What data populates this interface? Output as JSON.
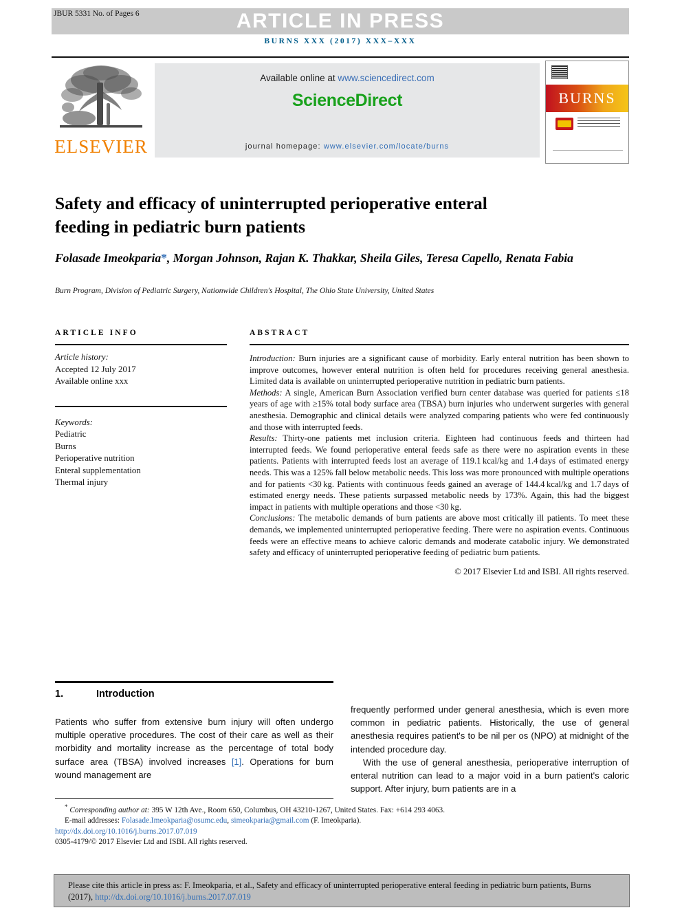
{
  "header": {
    "jbur_label": "JBUR 5331 No. of Pages 6",
    "press_banner": "ARTICLE IN PRESS",
    "journal_line": "BURNS XXX (2017) XXX–XXX"
  },
  "masthead": {
    "publisher": "ELSEVIER",
    "available_prefix": "Available online at ",
    "available_url": "www.sciencedirect.com",
    "sciencedirect_logo": "ScienceDirect",
    "homepage_label": "journal homepage: ",
    "homepage_url": "www.elsevier.com/locate/burns",
    "cover_title": "BURNS"
  },
  "article": {
    "title": "Safety and efficacy of uninterrupted perioperative enteral feeding in pediatric burn patients",
    "authors": "Folasade Imeokparia",
    "authors_rest": ", Morgan Johnson, Rajan K. Thakkar, Sheila Giles, Teresa Capello, Renata Fabia",
    "corresponding_marker": "*",
    "affiliation": "Burn Program, Division of Pediatric Surgery, Nationwide Children's Hospital, The Ohio State University, United States"
  },
  "article_info": {
    "heading": "ARTICLE INFO",
    "history_label": "Article history:",
    "accepted": "Accepted 12 July 2017",
    "available_online": "Available online xxx",
    "keywords_label": "Keywords:",
    "keywords": [
      "Pediatric",
      "Burns",
      "Perioperative nutrition",
      "Enteral supplementation",
      "Thermal injury"
    ]
  },
  "abstract": {
    "heading": "ABSTRACT",
    "sections": [
      {
        "label": "Introduction:",
        "text": " Burn injuries are a significant cause of morbidity. Early enteral nutrition has been shown to improve outcomes, however enteral nutrition is often held for procedures receiving general anesthesia. Limited data is available on uninterrupted perioperative nutrition in pediatric burn patients."
      },
      {
        "label": "Methods:",
        "text": " A single, American Burn Association verified burn center database was queried for patients ≤18 years of age with ≥15% total body surface area (TBSA) burn injuries who underwent surgeries with general anesthesia. Demographic and clinical details were analyzed comparing patients who were fed continuously and those with interrupted feeds."
      },
      {
        "label": "Results:",
        "text": " Thirty-one patients met inclusion criteria. Eighteen had continuous feeds and thirteen had interrupted feeds. We found perioperative enteral feeds safe as there were no aspiration events in these patients. Patients with interrupted feeds lost an average of 119.1 kcal/kg and 1.4 days of estimated energy needs. This was a 125% fall below metabolic needs. This loss was more pronounced with multiple operations and for patients <30 kg. Patients with continuous feeds gained an average of 144.4 kcal/kg and 1.7 days of estimated energy needs. These patients surpassed metabolic needs by 173%. Again, this had the biggest impact in patients with multiple operations and those <30 kg."
      },
      {
        "label": "Conclusions:",
        "text": " The metabolic demands of burn patients are above most critically ill patients. To meet these demands, we implemented uninterrupted perioperative feeding. There were no aspiration events. Continuous feeds were an effective means to achieve caloric demands and moderate catabolic injury. We demonstrated safety and efficacy of uninterrupted perioperative feeding of pediatric burn patients."
      }
    ],
    "copyright": "© 2017 Elsevier Ltd and ISBI. All rights reserved."
  },
  "introduction": {
    "number": "1.",
    "title": "Introduction",
    "left_paragraphs": [
      "Patients who suffer from extensive burn injury will often undergo multiple operative procedures. The cost of their care as well as their morbidity and mortality increase as the percentage of total body surface area (TBSA) involved increases ",
      ". Operations for burn wound management are"
    ],
    "reference_marker": "[1]",
    "right_paragraphs": [
      "frequently performed under general anesthesia, which is even more common in pediatric patients. Historically, the use of general anesthesia requires patient's to be nil per os (NPO) at midnight of the intended procedure day.",
      "With the use of general anesthesia, perioperative interruption of enteral nutrition can lead to a major void in a burn patient's caloric support. After injury, burn patients are in a"
    ]
  },
  "footnotes": {
    "corresponding_marker": "*",
    "corresponding_label": "Corresponding author at:",
    "corresponding_text": " 395 W 12th Ave., Room 650, Columbus, OH 43210-1267, United States. Fax: +614 293 4063.",
    "email_label": "E-mail addresses:",
    "email_1": "Folasade.Imeokparia@osumc.edu",
    "email_sep": ", ",
    "email_2": "simeokparia@gmail.com",
    "email_suffix": " (F. Imeokparia).",
    "doi": "http://dx.doi.org/10.1016/j.burns.2017.07.019",
    "issn_line": "0305-4179/© 2017 Elsevier Ltd and ISBI. All rights reserved."
  },
  "cite_box": {
    "text_before": "Please cite this article in press as: F. Imeokparia, et al., Safety and efficacy of uninterrupted perioperative enteral feeding in pediatric burn patients, Burns (2017), ",
    "doi_link": "http://dx.doi.org/10.1016/j.burns.2017.07.019"
  },
  "colors": {
    "banner_gray": "#c9c9c9",
    "journal_blue": "#005c8a",
    "link_blue": "#2f6cb5",
    "sciencedirect_green": "#18a11b",
    "elsevier_orange": "#f08000",
    "cite_box_gray": "#bdbdbd"
  }
}
